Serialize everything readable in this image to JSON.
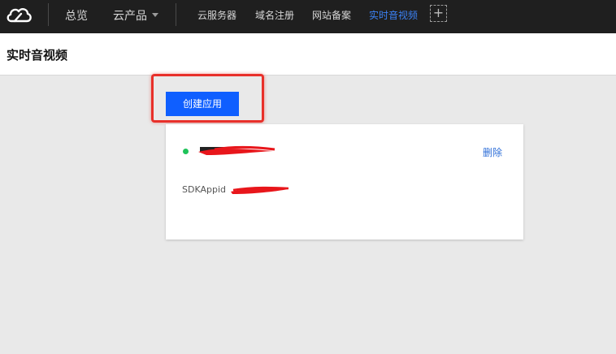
{
  "nav": {
    "overview": "总览",
    "products": "云产品",
    "links": [
      {
        "label": "云服务器",
        "active": false
      },
      {
        "label": "域名注册",
        "active": false
      },
      {
        "label": "网站备案",
        "active": false
      },
      {
        "label": "实时音视频",
        "active": true
      }
    ],
    "add_symbol": "+"
  },
  "page": {
    "title": "实时音视频",
    "create_button": "创建应用"
  },
  "app_card": {
    "status": "active",
    "delete_label": "删除",
    "sdk_label": "SDKAppid"
  },
  "colors": {
    "topbar": "#1f1f1f",
    "accent_blue": "#0f5fff",
    "active_link": "#3b82f6",
    "highlight_red": "#e8302a",
    "status_green": "#1fc35a"
  },
  "icons": {
    "logo": "cloud-icon",
    "products_dropdown": "caret-down-icon",
    "add": "plus-icon"
  }
}
